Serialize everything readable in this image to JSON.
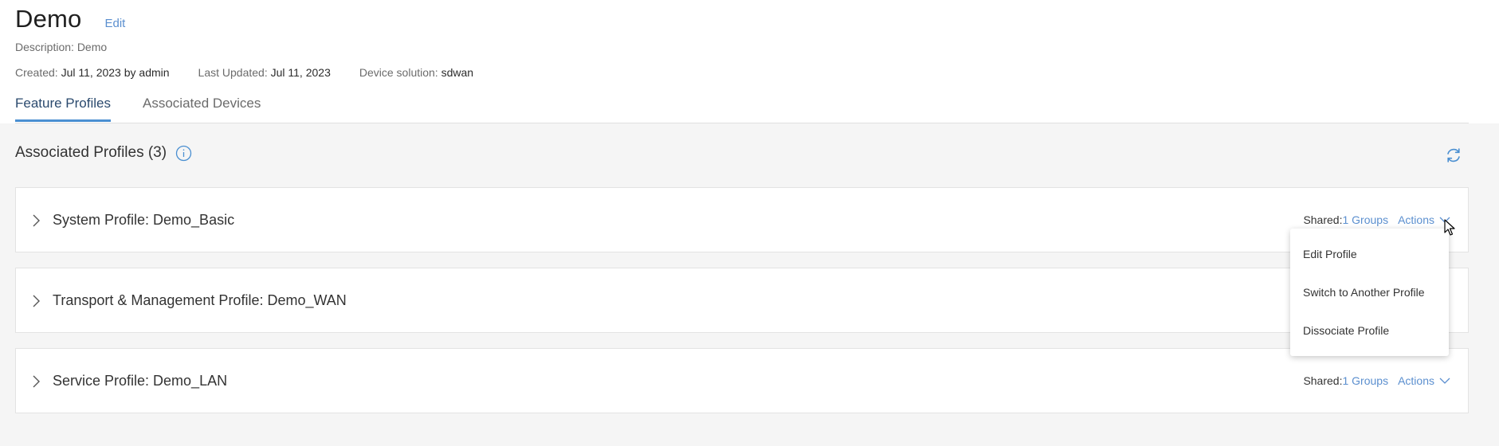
{
  "header": {
    "title": "Demo",
    "edit_label": "Edit",
    "description_label": "Description:",
    "description_value": "Demo",
    "created_label": "Created:",
    "created_value": "Jul 11, 2023 by admin",
    "updated_label": "Last Updated:",
    "updated_value": "Jul 11, 2023",
    "solution_label": "Device solution:",
    "solution_value": "sdwan"
  },
  "tabs": [
    {
      "label": "Feature Profiles",
      "active": true
    },
    {
      "label": "Associated Devices",
      "active": false
    }
  ],
  "section": {
    "title": "Associated Profiles (3)",
    "info_icon": "info-icon",
    "refresh_icon": "refresh-icon"
  },
  "profiles": [
    {
      "name": "System Profile: Demo_Basic",
      "shared_label": "Shared:",
      "groups": "1 Groups",
      "actions_label": "Actions",
      "show_right": true
    },
    {
      "name": "Transport & Management Profile: Demo_WAN",
      "shared_label": "",
      "groups": "",
      "actions_label": "",
      "show_right": false
    },
    {
      "name": "Service Profile: Demo_LAN",
      "shared_label": "Shared:",
      "groups": "1 Groups",
      "actions_label": "Actions",
      "show_right": true
    }
  ],
  "dropdown": {
    "items": [
      "Edit Profile",
      "Switch to Another Profile",
      "Dissociate Profile"
    ]
  },
  "colors": {
    "accent": "#4a8fd1",
    "link": "#5b8fcf",
    "content_bg": "#f5f5f5"
  }
}
